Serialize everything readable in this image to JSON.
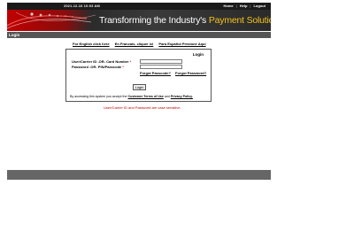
{
  "header": {
    "datetime": "2021-12-16 10:03 AM",
    "links": [
      "Home",
      "Help",
      "Logout"
    ],
    "tagline_prefix": "Transforming the Industry's",
    "tagline_highlight": "Payment Solutions"
  },
  "nav": {
    "label": "Login"
  },
  "languages": [
    "For English click here",
    "En Francais, cliquer ici",
    "Para Español Presione Aqui"
  ],
  "login": {
    "title": "Login",
    "user_label": "User/Carrier ID -OR- Card Number",
    "password_label": "Password -OR- PIN/Passcode",
    "required_marker": "*",
    "user_value": "",
    "password_value": "",
    "forgot_passcode": "Forgot Passcode?",
    "forgot_password": "Forgot Password?",
    "submit_label": "Login",
    "agreement_prefix": "By accessing this system you accept the",
    "terms_link": "Customer Terms of Use",
    "agreement_and": "and",
    "privacy_link": "Privacy Policy."
  },
  "note": "User/Carrier ID and Password are case sensitive.",
  "colors": {
    "brand_red": "#c00000",
    "accent_yellow": "#f3c21b",
    "top_bar": "#1a1a1a",
    "nav_bar": "#555555",
    "footer": "#666666"
  }
}
